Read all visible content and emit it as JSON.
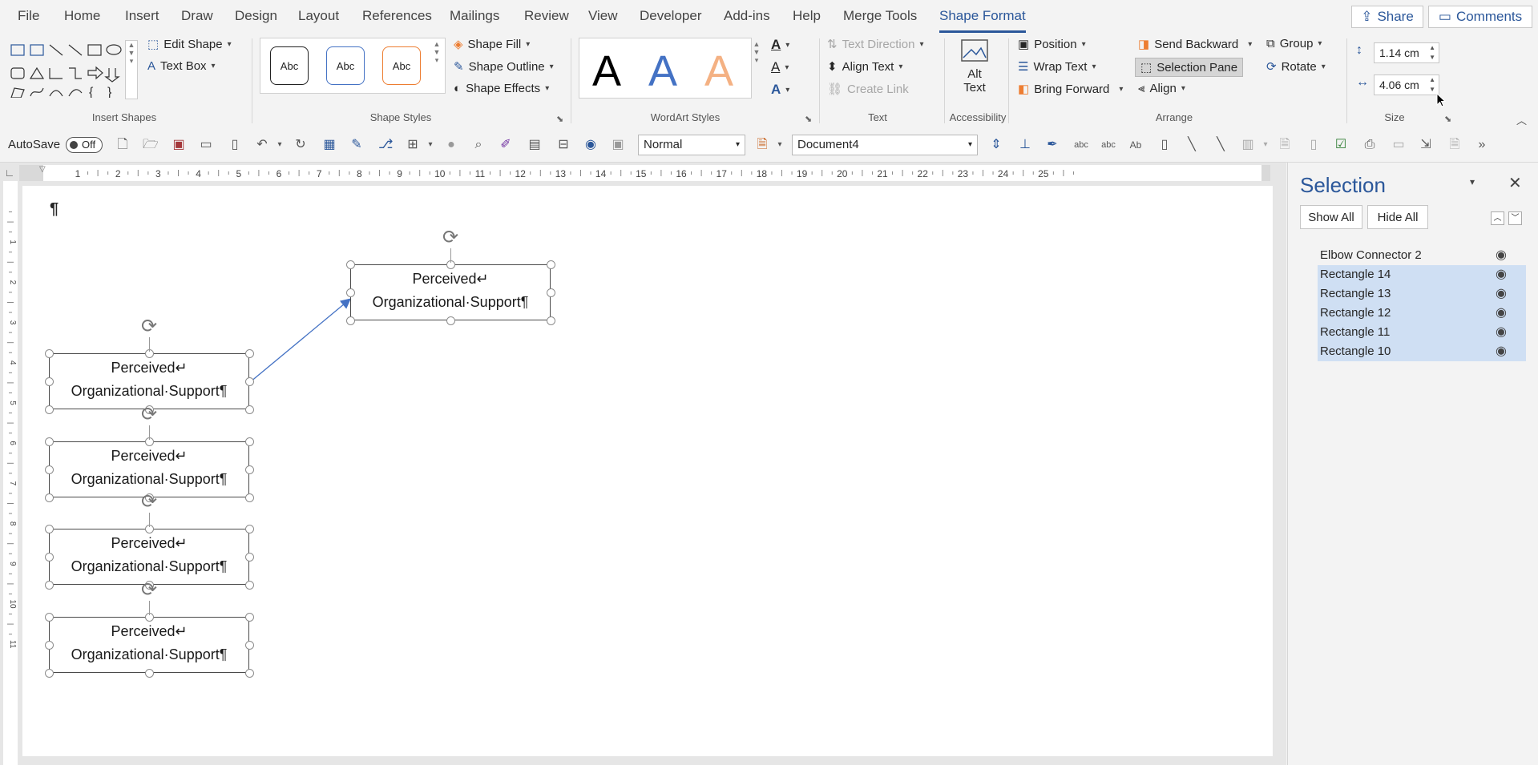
{
  "tabs": [
    "File",
    "Home",
    "Insert",
    "Draw",
    "Design",
    "Layout",
    "References",
    "Mailings",
    "Review",
    "View",
    "Developer",
    "Add-ins",
    "Help",
    "Merge Tools",
    "Shape Format"
  ],
  "active_tab": "Shape Format",
  "share_label": "Share",
  "comments_label": "Comments",
  "ribbon": {
    "insert_shapes": {
      "edit_shape": "Edit Shape",
      "text_box": "Text Box",
      "label": "Insert Shapes"
    },
    "shape_styles": {
      "style_samples": [
        "Abc",
        "Abc",
        "Abc"
      ],
      "fill": "Shape Fill",
      "outline": "Shape Outline",
      "effects": "Shape Effects",
      "label": "Shape Styles"
    },
    "wordart": {
      "samples": [
        "A",
        "A",
        "A"
      ],
      "label": "WordArt Styles"
    },
    "text": {
      "direction": "Text Direction",
      "align": "Align Text",
      "link": "Create Link",
      "label": "Text"
    },
    "accessibility": {
      "alt_text_line1": "Alt",
      "alt_text_line2": "Text",
      "label": "Accessibility"
    },
    "arrange": {
      "position": "Position",
      "wrap_text": "Wrap Text",
      "bring_forward": "Bring Forward",
      "send_backward": "Send Backward",
      "selection_pane": "Selection Pane",
      "align": "Align",
      "group": "Group",
      "rotate": "Rotate",
      "label": "Arrange"
    },
    "size": {
      "height": "1.14 cm",
      "width": "4.06 cm",
      "label": "Size"
    }
  },
  "qat": {
    "autosave_label": "AutoSave",
    "autosave_state": "Off",
    "style_value": "Normal",
    "document_value": "Document4"
  },
  "ruler": {
    "h_ticks": [
      "1",
      "2",
      "3",
      "4",
      "5",
      "6",
      "7",
      "8",
      "9",
      "10",
      "11",
      "12",
      "13",
      "14",
      "15",
      "16",
      "17",
      "18",
      "19",
      "20",
      "21",
      "22",
      "23",
      "24",
      "25"
    ],
    "v_ticks": [
      "1",
      "2",
      "3",
      "4",
      "5",
      "6",
      "7",
      "8",
      "9",
      "10",
      "11"
    ]
  },
  "document": {
    "pilcrow": "¶",
    "shape_line1": "Perceived↵",
    "shape_line2": "Organizational·Support¶"
  },
  "selection_pane": {
    "title": "Selection",
    "show_all": "Show All",
    "hide_all": "Hide All",
    "items": [
      {
        "name": "Elbow Connector 2",
        "selected": false
      },
      {
        "name": "Rectangle 14",
        "selected": true
      },
      {
        "name": "Rectangle 13",
        "selected": true
      },
      {
        "name": "Rectangle 12",
        "selected": true
      },
      {
        "name": "Rectangle 11",
        "selected": true
      },
      {
        "name": "Rectangle 10",
        "selected": true
      }
    ]
  },
  "colors": {
    "accent": "#2b579a",
    "selection": "#cfdff3",
    "connector": "#4472c4"
  }
}
